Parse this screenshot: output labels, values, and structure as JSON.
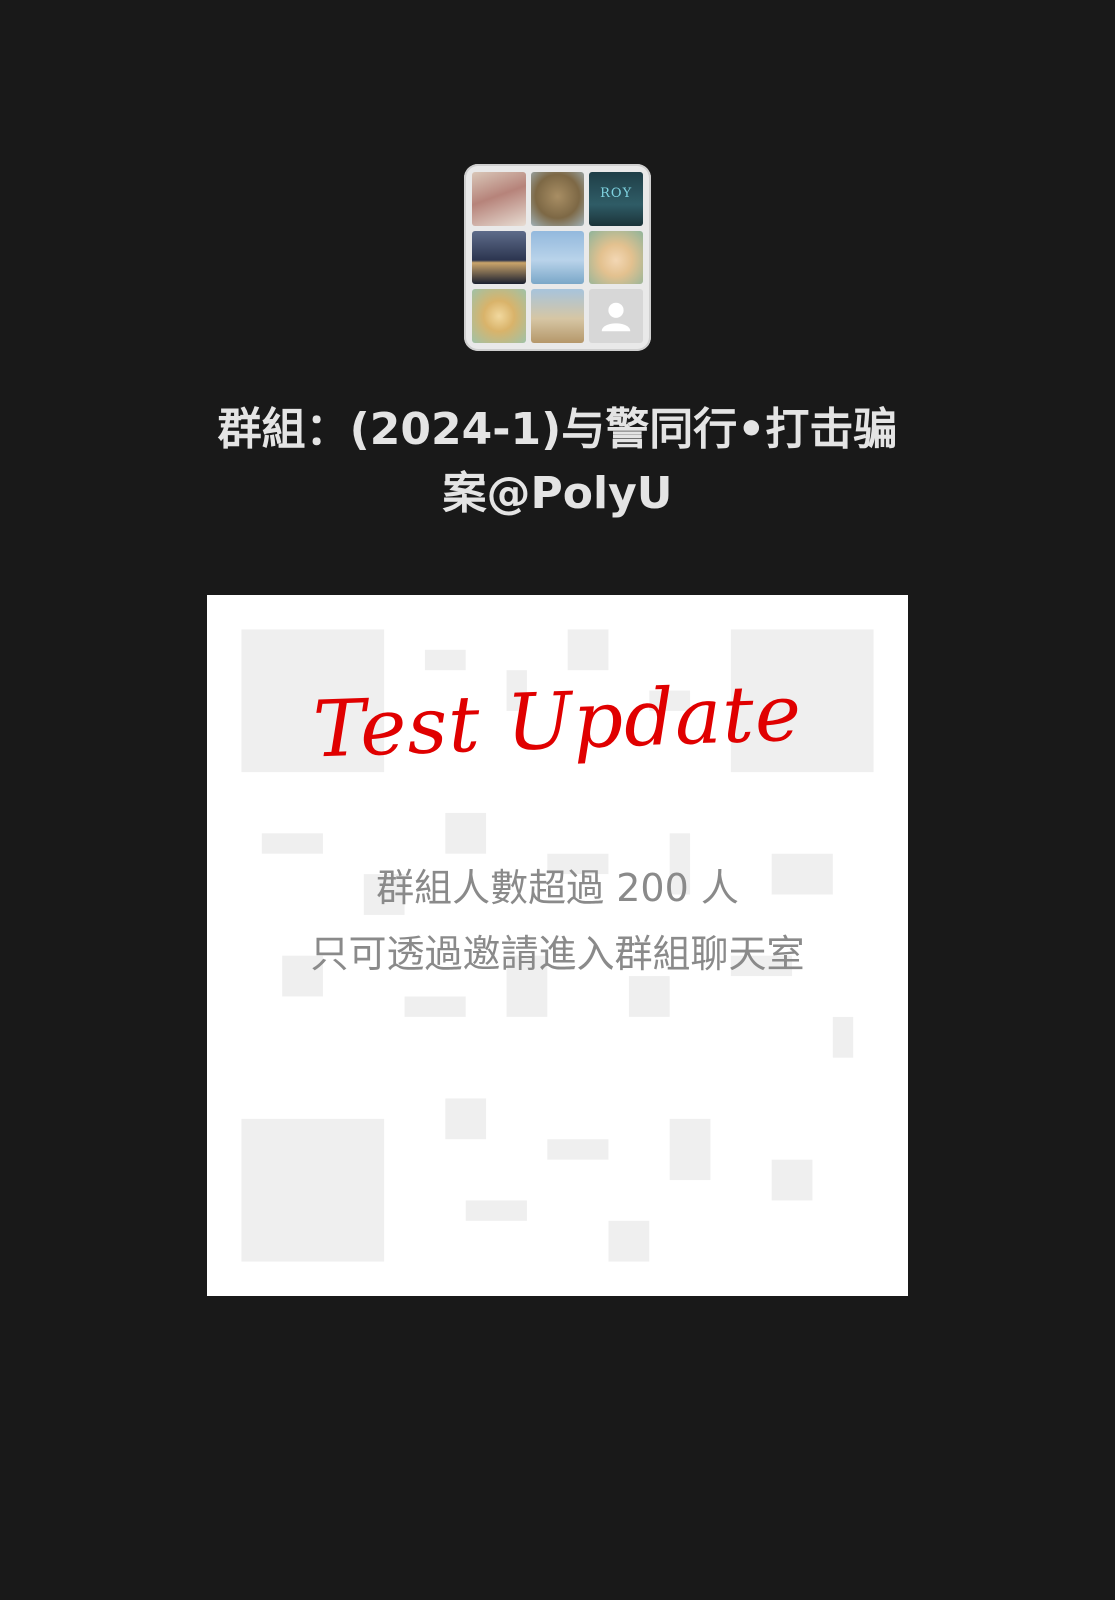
{
  "group": {
    "title_line1": "群組：(2024-1)与警同行•打击骗",
    "title_line2": "案@PolyU"
  },
  "avatar": {
    "tiles": [
      "member-photo",
      "member-photo",
      "member-photo",
      "member-photo",
      "member-photo",
      "member-photo",
      "member-photo",
      "member-photo",
      "default-person-icon"
    ],
    "tile3_text": "ROY"
  },
  "qr_card": {
    "stamp_text": "Test Update",
    "notice_line1": "群組人數超過 200 人",
    "notice_line2": "只可透過邀請進入群組聊天室"
  },
  "colors": {
    "background": "#191919",
    "title": "#e4e4e4",
    "stamp": "#e00000",
    "notice": "#8a8a8a"
  }
}
